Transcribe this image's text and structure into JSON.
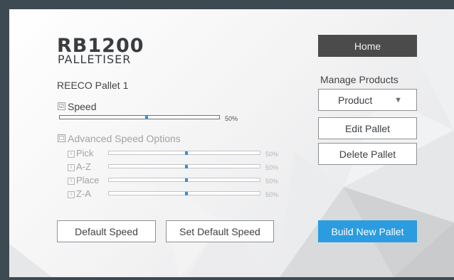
{
  "logo": {
    "main": "RB1200",
    "sub": "PALLETISER"
  },
  "pallet_name": "REECO Pallet 1",
  "speed": {
    "label": "Speed",
    "checked": true,
    "value": "50%"
  },
  "advanced": {
    "label": "Advanced Speed Options",
    "checked": false,
    "rows": [
      {
        "label": "Pick",
        "value": "50%"
      },
      {
        "label": "A-Z",
        "value": "50%"
      },
      {
        "label": "Place",
        "value": "50%"
      },
      {
        "label": "Z-A",
        "value": "50%"
      }
    ]
  },
  "buttons": {
    "home": "Home",
    "manage_products": "Manage Products",
    "product_select": "Product",
    "edit_pallet": "Edit Pallet",
    "delete_pallet": "Delete Pallet",
    "default_speed": "Default Speed",
    "set_default_speed": "Set Default Speed",
    "build_new_pallet": "Build New Pallet"
  },
  "colors": {
    "accent": "#2b9ce0",
    "home_bg": "#4b4b4b",
    "frame": "#3e4a52",
    "slider_knob": "#3a8fd0"
  },
  "icons": {
    "checkbox_checked": "☑",
    "checkbox_unchecked": "☐",
    "dropdown": "▼",
    "info": "i"
  }
}
